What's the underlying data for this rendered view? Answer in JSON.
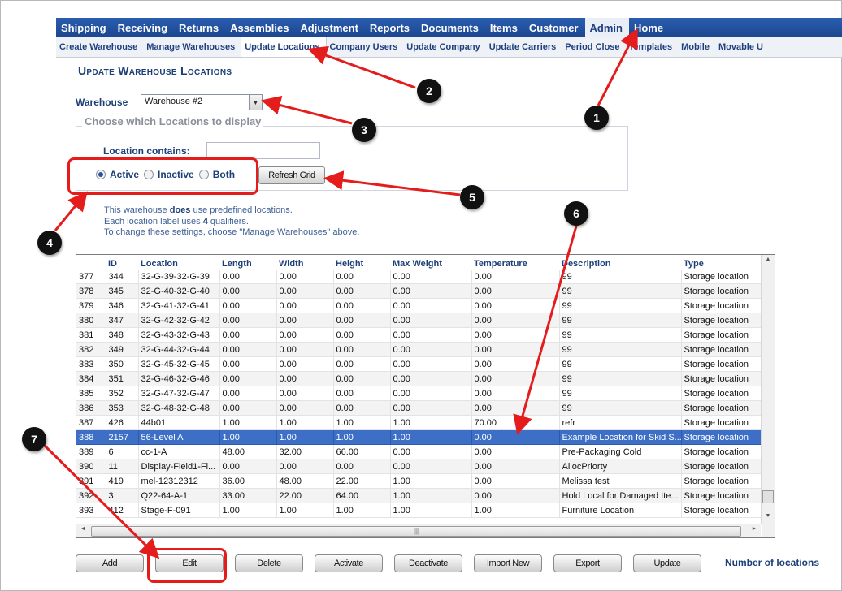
{
  "topnav": {
    "items": [
      "Shipping",
      "Receiving",
      "Returns",
      "Assemblies",
      "Adjustment",
      "Reports",
      "Documents",
      "Items",
      "Customer",
      "Admin",
      "Home"
    ],
    "active": "Admin"
  },
  "subnav": {
    "items": [
      "Create Warehouse",
      "Manage Warehouses",
      "Update Locations",
      "Company Users",
      "Update Company",
      "Update Carriers",
      "Period Close",
      "Templates",
      "Mobile",
      "Movable U"
    ],
    "active": "Update Locations"
  },
  "page": {
    "title": "Update Warehouse Locations",
    "warehouse_label": "Warehouse",
    "warehouse_value": "Warehouse #2",
    "filter_legend": "Choose which Locations to display",
    "location_contains_label": "Location contains:",
    "location_contains_value": "",
    "radio_active": "Active",
    "radio_inactive": "Inactive",
    "radio_both": "Both",
    "radio_selected": "Active",
    "refresh_button": "Refresh Grid",
    "info_line1_pre": "This warehouse ",
    "info_line1_bold": "does",
    "info_line1_post": " use predefined locations.",
    "info_line2_pre": "Each location label uses ",
    "info_line2_bold": "4",
    "info_line2_post": " qualifiers.",
    "info_line3": "To change these settings, choose \"Manage Warehouses\" above."
  },
  "grid": {
    "columns": [
      "",
      "ID",
      "Location",
      "Length",
      "Width",
      "Height",
      "Max Weight",
      "Temperature",
      "Description",
      "Type"
    ],
    "selected_row": 388,
    "rows": [
      [
        "377",
        "344",
        "32-G-39-32-G-39",
        "0.00",
        "0.00",
        "0.00",
        "0.00",
        "0.00",
        "99",
        "Storage location"
      ],
      [
        "378",
        "345",
        "32-G-40-32-G-40",
        "0.00",
        "0.00",
        "0.00",
        "0.00",
        "0.00",
        "99",
        "Storage location"
      ],
      [
        "379",
        "346",
        "32-G-41-32-G-41",
        "0.00",
        "0.00",
        "0.00",
        "0.00",
        "0.00",
        "99",
        "Storage location"
      ],
      [
        "380",
        "347",
        "32-G-42-32-G-42",
        "0.00",
        "0.00",
        "0.00",
        "0.00",
        "0.00",
        "99",
        "Storage location"
      ],
      [
        "381",
        "348",
        "32-G-43-32-G-43",
        "0.00",
        "0.00",
        "0.00",
        "0.00",
        "0.00",
        "99",
        "Storage location"
      ],
      [
        "382",
        "349",
        "32-G-44-32-G-44",
        "0.00",
        "0.00",
        "0.00",
        "0.00",
        "0.00",
        "99",
        "Storage location"
      ],
      [
        "383",
        "350",
        "32-G-45-32-G-45",
        "0.00",
        "0.00",
        "0.00",
        "0.00",
        "0.00",
        "99",
        "Storage location"
      ],
      [
        "384",
        "351",
        "32-G-46-32-G-46",
        "0.00",
        "0.00",
        "0.00",
        "0.00",
        "0.00",
        "99",
        "Storage location"
      ],
      [
        "385",
        "352",
        "32-G-47-32-G-47",
        "0.00",
        "0.00",
        "0.00",
        "0.00",
        "0.00",
        "99",
        "Storage location"
      ],
      [
        "386",
        "353",
        "32-G-48-32-G-48",
        "0.00",
        "0.00",
        "0.00",
        "0.00",
        "0.00",
        "99",
        "Storage location"
      ],
      [
        "387",
        "426",
        "44b01",
        "1.00",
        "1.00",
        "1.00",
        "1.00",
        "70.00",
        "refr",
        "Storage location"
      ],
      [
        "388",
        "2157",
        "56-Level A",
        "1.00",
        "1.00",
        "1.00",
        "1.00",
        "0.00",
        "Example Location for Skid S...",
        "Storage location"
      ],
      [
        "389",
        "6",
        "cc-1-A",
        "48.00",
        "32.00",
        "66.00",
        "0.00",
        "0.00",
        "Pre-Packaging Cold",
        "Storage location"
      ],
      [
        "390",
        "11",
        "Display-Field1-Fi...",
        "0.00",
        "0.00",
        "0.00",
        "0.00",
        "0.00",
        "AllocPriorty",
        "Storage location"
      ],
      [
        "391",
        "419",
        "mel-12312312",
        "36.00",
        "48.00",
        "22.00",
        "1.00",
        "0.00",
        "Melissa test",
        "Storage location"
      ],
      [
        "392",
        "3",
        "Q22-64-A-1",
        "33.00",
        "22.00",
        "64.00",
        "1.00",
        "0.00",
        "Hold Local for Damaged Ite...",
        "Storage location"
      ],
      [
        "393",
        "412",
        "Stage-F-091",
        "1.00",
        "1.00",
        "1.00",
        "1.00",
        "1.00",
        "Furniture Location",
        "Storage location"
      ]
    ]
  },
  "buttons": [
    "Add",
    "Edit",
    "Delete",
    "Activate",
    "Deactivate",
    "Import New",
    "Export",
    "Update"
  ],
  "count_label": "Number of locations",
  "annotations": [
    "1",
    "2",
    "3",
    "4",
    "5",
    "6",
    "7"
  ],
  "colors": {
    "nav_blue": "#1f4e9c",
    "selected_row": "#3d6fc7",
    "annotation_red": "#e41c1c"
  }
}
